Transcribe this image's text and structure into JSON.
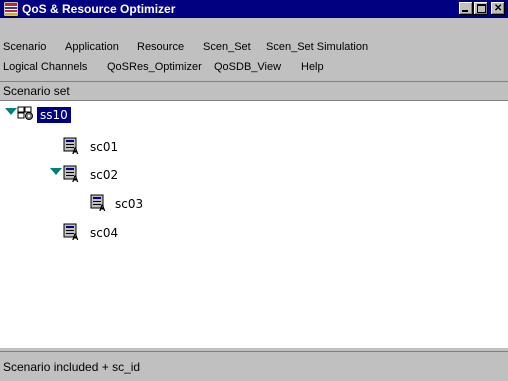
{
  "window": {
    "title": "QoS & Resource Optimizer",
    "title_bar_color": "#000080",
    "icon": "app-flag-icon",
    "buttons": [
      "minimize",
      "maximize",
      "close"
    ]
  },
  "menubar": {
    "row1": [
      "Scenario",
      "Application",
      "Resource",
      "Scen_Set",
      "Scen_Set Simulation"
    ],
    "row2": [
      "Logical Channels",
      "QoSRes_Optimizer",
      "QoSDB_View",
      "Help"
    ]
  },
  "panel": {
    "header": "Scenario set"
  },
  "tree": {
    "root": {
      "label": "ss10",
      "expanded": true,
      "selected": true,
      "icon": "scenario-set-icon"
    },
    "nodes": [
      {
        "label": "sc01",
        "depth": 1,
        "expanded": false,
        "icon": "scenario-icon"
      },
      {
        "label": "sc02",
        "depth": 1,
        "expanded": true,
        "icon": "scenario-icon"
      },
      {
        "label": "sc03",
        "depth": 2,
        "expanded": false,
        "icon": "scenario-icon"
      },
      {
        "label": "sc04",
        "depth": 1,
        "expanded": false,
        "icon": "scenario-icon"
      }
    ],
    "selection_color": "#000080",
    "toggle_color": "#008080"
  },
  "statusbar": {
    "text": "Scenario included + sc_id"
  }
}
